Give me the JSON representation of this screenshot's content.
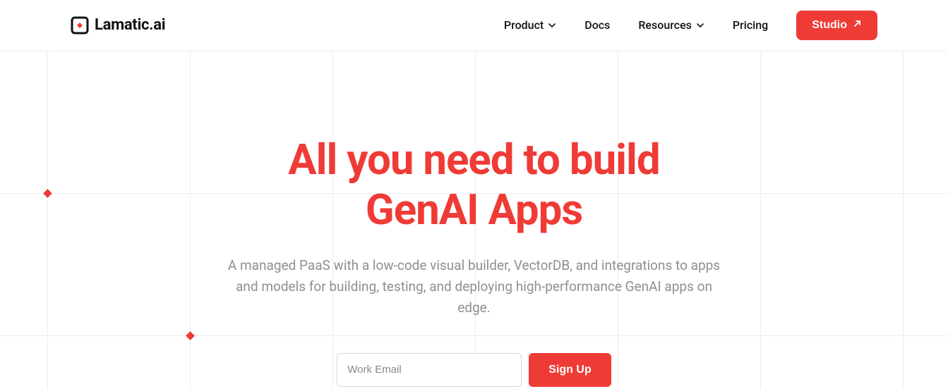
{
  "brand": {
    "name": "Lamatic.ai"
  },
  "nav": {
    "product": "Product",
    "docs": "Docs",
    "resources": "Resources",
    "pricing": "Pricing",
    "studio": "Studio"
  },
  "hero": {
    "headline_l1": "All you need to build",
    "headline_l2": "GenAI Apps",
    "sub": "A managed PaaS with a low-code visual builder, VectorDB, and integrations to apps and models for building, testing, and deploying high-performance GenAI apps on edge."
  },
  "signup": {
    "placeholder": "Work Email",
    "button": "Sign Up"
  },
  "colors": {
    "accent": "#ef3b36"
  }
}
